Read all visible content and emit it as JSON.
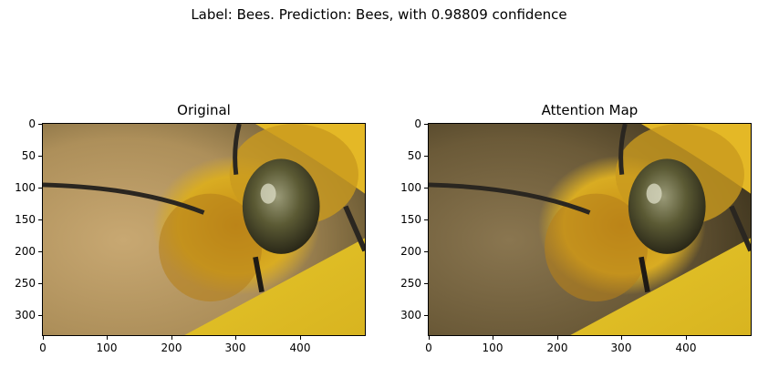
{
  "figure": {
    "suptitle": "Label: Bees. Prediction: Bees, with 0.98809 confidence"
  },
  "panels": [
    {
      "title": "Original",
      "y_ticks": [
        "0",
        "50",
        "100",
        "150",
        "200",
        "250",
        "300"
      ],
      "x_ticks": [
        "0",
        "100",
        "200",
        "300",
        "400"
      ]
    },
    {
      "title": "Attention Map",
      "y_ticks": [
        "0",
        "50",
        "100",
        "150",
        "200",
        "250",
        "300"
      ],
      "x_ticks": [
        "0",
        "100",
        "200",
        "300",
        "400"
      ]
    }
  ],
  "image": {
    "width_units": 500,
    "height_units": 333,
    "colors": {
      "background_warm": "#b89a62",
      "background_dark": "#5a4a2c",
      "fur": "#d4a41c",
      "fur_dark": "#8a6010",
      "eye": "#4b4a2a",
      "flower": "#e8c830",
      "antenna": "#2a2620"
    }
  }
}
